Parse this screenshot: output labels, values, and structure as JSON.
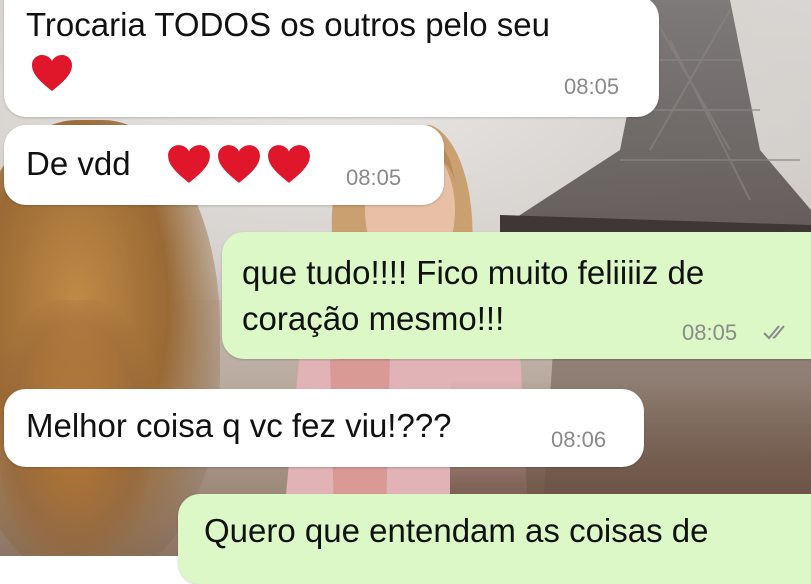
{
  "messages": [
    {
      "id": "m1",
      "direction": "incoming",
      "text": "Trocaria TODOS os outros pelo seu",
      "emoji": "❤️",
      "emoji_count": 1,
      "time": "08:05"
    },
    {
      "id": "m2",
      "direction": "incoming",
      "text": "De vdd",
      "emoji": "❤️",
      "emoji_count": 3,
      "time": "08:05"
    },
    {
      "id": "m3",
      "direction": "outgoing",
      "lines": [
        "que tudo!!!! Fico muito feliiiiz de",
        "coração mesmo!!!"
      ],
      "time": "08:05",
      "status": "read",
      "status_icon": "double-check-icon"
    },
    {
      "id": "m4",
      "direction": "incoming",
      "text": "Melhor coisa q vc fez viu!???",
      "time": "08:06"
    },
    {
      "id": "m5",
      "direction": "outgoing",
      "text": "Quero que entendam as coisas de"
    }
  ],
  "colors": {
    "incoming_bubble": "#ffffff",
    "outgoing_bubble": "#dcf8c6",
    "heart": "#e0162b",
    "timestamp": "#8a8a8a",
    "read_ticks": "#8a8a8a"
  }
}
